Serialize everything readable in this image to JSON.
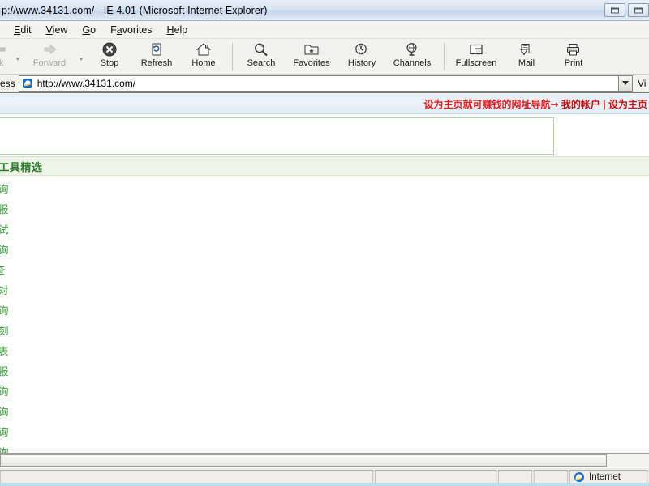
{
  "window": {
    "title": "p://www.34131.com/ - IE 4.01 (Microsoft Internet Explorer)",
    "restore_button": "restore-window-button",
    "close_button": "close-window-button"
  },
  "menubar": {
    "items": [
      {
        "label": "Edit",
        "accel": "E"
      },
      {
        "label": "View",
        "accel": "V"
      },
      {
        "label": "Go",
        "accel": "G"
      },
      {
        "label": "Favorites",
        "accel": "a"
      },
      {
        "label": "Help",
        "accel": "H"
      }
    ]
  },
  "toolbar": {
    "buttons": [
      {
        "label": "ck",
        "icon": "back-arrow-icon",
        "disabled": true
      },
      {
        "label": "Forward",
        "icon": "forward-arrow-icon",
        "disabled": true
      },
      {
        "label": "Stop",
        "icon": "stop-icon",
        "disabled": false
      },
      {
        "label": "Refresh",
        "icon": "refresh-icon",
        "disabled": false
      },
      {
        "label": "Home",
        "icon": "home-icon",
        "disabled": false
      },
      {
        "label": "Search",
        "icon": "search-icon",
        "disabled": false
      },
      {
        "label": "Favorites",
        "icon": "favorites-folder-icon",
        "disabled": false
      },
      {
        "label": "History",
        "icon": "history-globe-icon",
        "disabled": false
      },
      {
        "label": "Channels",
        "icon": "channels-icon",
        "disabled": false
      },
      {
        "label": "Fullscreen",
        "icon": "fullscreen-icon",
        "disabled": false
      },
      {
        "label": "Mail",
        "icon": "mail-icon",
        "disabled": false
      },
      {
        "label": "Print",
        "icon": "print-icon",
        "disabled": false
      }
    ]
  },
  "addressbar": {
    "label": "ess",
    "url": "http://www.34131.com/",
    "favicon": "ie-page-icon",
    "dropdown": "address-history-dropdown",
    "links_label": "Vi"
  },
  "page": {
    "promo": {
      "slogan": "设为主页就可赚钱的网址导航→",
      "account_link": "我的帐户",
      "separator": "|",
      "homepage_link": "设为主页"
    },
    "search_box_placeholder": "",
    "tools_section_title": "...工具精选",
    "links": [
      "气预报查询",
      "视节目预报",
      "网速度测试",
      "机属地查询",
      "地址速查",
      "京时间校对",
      "车时刻查询",
      "途汽车时刻",
      "年历查询表",
      "界天气预报",
      "份证号查询",
      "机号码查询",
      "编区号查询",
      "递单号查询"
    ]
  },
  "statusbar": {
    "message": "",
    "cell2": "",
    "cell3": "",
    "cell4": "",
    "zone": "Internet",
    "zone_icon": "ie-internet-zone-icon"
  },
  "colors": {
    "promo_red": "#e02020",
    "link_green": "#3aa23a",
    "section_green": "#2f7a2f",
    "tools_band": "#edf6e4",
    "blue_band": "#e9f1f8"
  }
}
